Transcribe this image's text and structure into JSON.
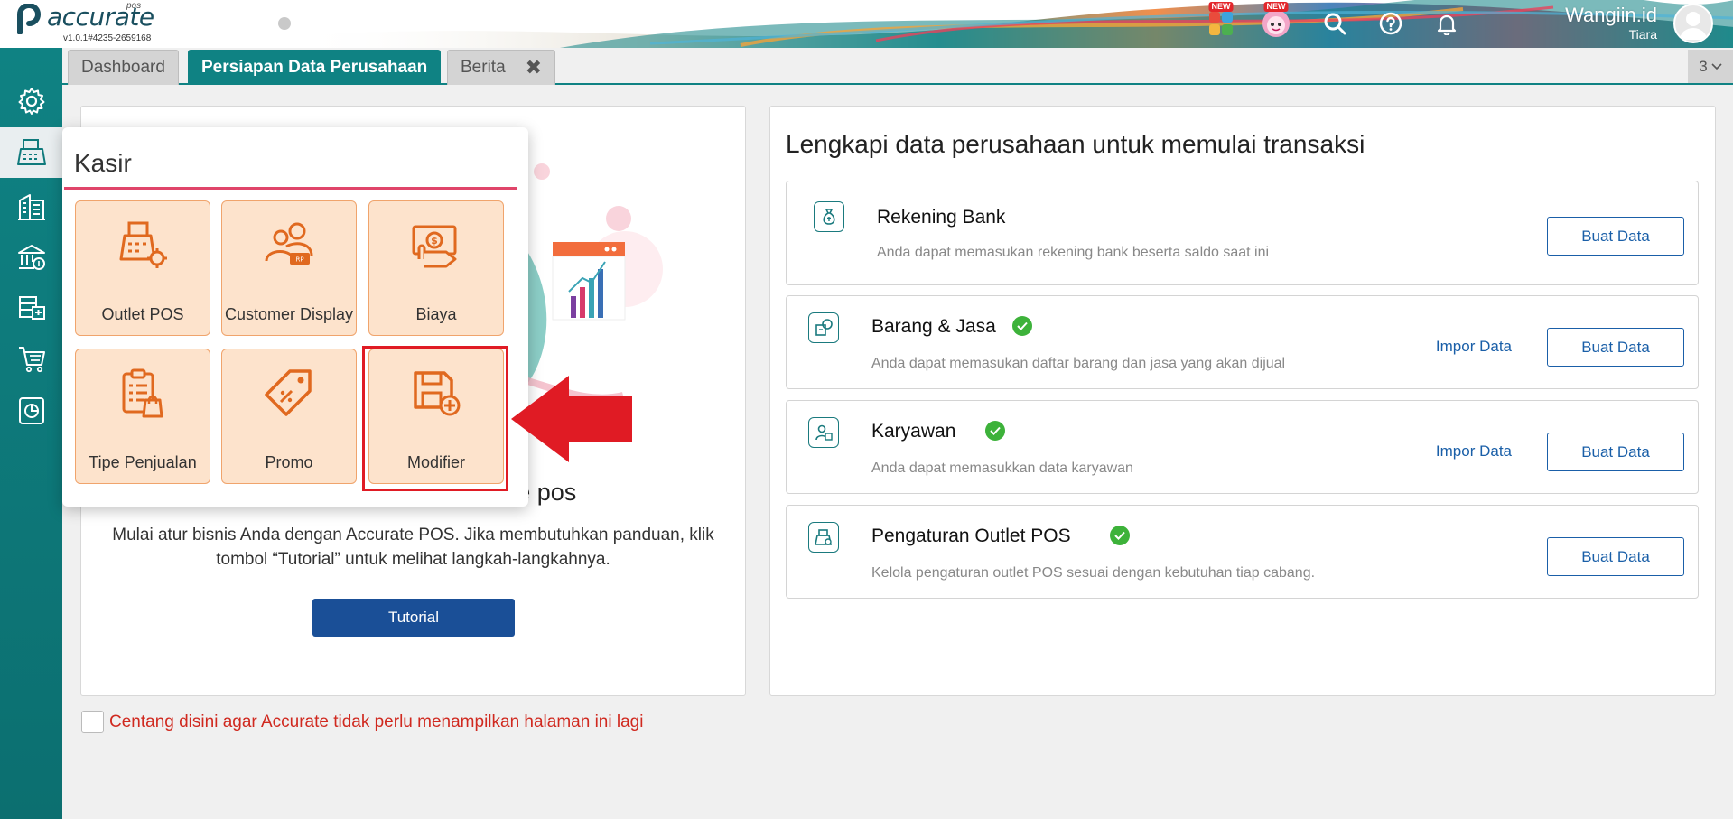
{
  "app": {
    "logo_text": "accurate",
    "logo_sub": "pos",
    "version": "v1.0.1#4235-2659168"
  },
  "header": {
    "new_badge_1": "NEW",
    "new_badge_2": "NEW",
    "icons": [
      "apps-icon",
      "mascot-icon",
      "search-icon",
      "help-icon",
      "bell-icon"
    ],
    "user_name": "Wangiin.id",
    "user_sub": "Tiara"
  },
  "sidebar": {
    "items": [
      "gear-icon",
      "cashier-icon",
      "building-icon",
      "bank-icon",
      "inventory-icon",
      "cart-icon",
      "report-icon"
    ],
    "active_index": 1
  },
  "tabs": {
    "items": [
      {
        "label": "Dashboard"
      },
      {
        "label": "Persiapan Data Perusahaan"
      },
      {
        "label": "Berita"
      }
    ],
    "close_symbol": "✖",
    "count": "3"
  },
  "left_card": {
    "heading_tail": "te pos",
    "description": "Mulai atur bisnis Anda dengan Accurate POS. Jika membutuhkan panduan, klik tombol “Tutorial” untuk melihat langkah-langkahnya.",
    "tutorial_label": "Tutorial"
  },
  "right_card": {
    "title": "Lengkapi data perusahaan untuk memulai transaksi",
    "rows": [
      {
        "title": "Rekening Bank",
        "desc": "Anda dapat memasukan rekening bank beserta saldo saat ini",
        "import": "",
        "create": "Buat Data"
      },
      {
        "title": "Barang & Jasa",
        "desc": "Anda dapat memasukan daftar barang dan jasa yang akan dijual",
        "import": "Impor Data",
        "create": "Buat Data"
      },
      {
        "title": "Karyawan",
        "desc": "Anda dapat memasukkan data karyawan",
        "import": "Impor Data",
        "create": "Buat Data"
      },
      {
        "title": "Pengaturan Outlet POS",
        "desc": "Kelola pengaturan outlet POS sesuai dengan kebutuhan tiap cabang.",
        "import": "",
        "create": "Buat Data"
      }
    ]
  },
  "footer": {
    "checkbox_label": "Centang disini agar Accurate tidak perlu menampilkan halaman ini lagi"
  },
  "kasir_menu": {
    "title": "Kasir",
    "tiles": [
      {
        "label": "Outlet POS"
      },
      {
        "label": "Customer Display"
      },
      {
        "label": "Biaya"
      },
      {
        "label": "Tipe Penjualan"
      },
      {
        "label": "Promo"
      },
      {
        "label": "Modifier"
      }
    ]
  },
  "colors": {
    "teal": "#0f8283",
    "orange": "#e0691f",
    "tile_bg": "#fde3cc",
    "annotation_red": "#e01b24",
    "link_blue": "#1a5fa8"
  }
}
